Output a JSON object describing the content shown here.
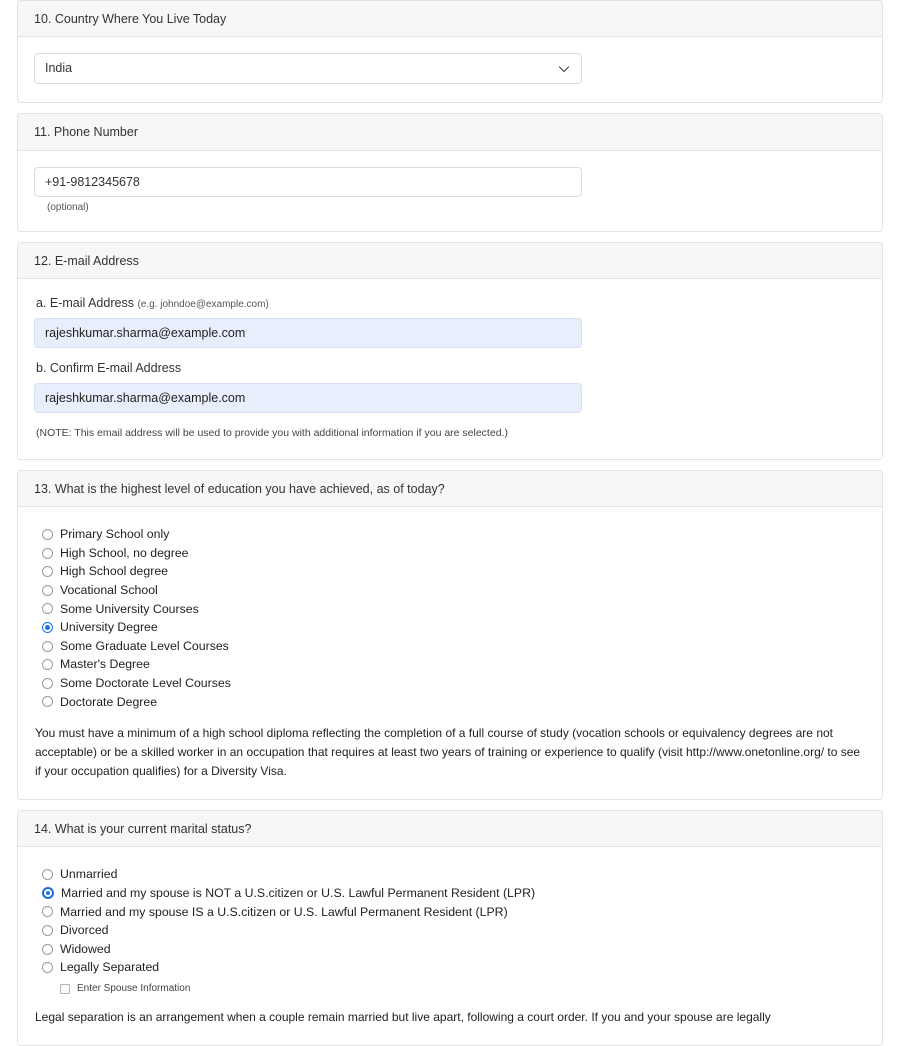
{
  "sections": [
    {
      "id": "country",
      "header": "10. Country Where You Live Today",
      "select_value": "India",
      "chevron_icon": "chevron-down-icon"
    },
    {
      "id": "phone",
      "header": "11. Phone Number",
      "phone_value": "+91-9812345678",
      "optional_note": "(optional)"
    },
    {
      "id": "email",
      "header": "12. E-mail Address",
      "email_label": "a. E-mail Address",
      "email_example": "(e.g. johndoe@example.com)",
      "email_value": "rajeshkumar.sharma@example.com",
      "confirm_label": "b. Confirm E-mail Address",
      "confirm_value": "rajeshkumar.sharma@example.com",
      "note": "(NOTE: This email address will be used to provide you with additional information if you are selected.)"
    },
    {
      "id": "education",
      "header": "13. What is the highest level of education you have achieved, as of today?",
      "options": [
        {
          "label": "Primary School only",
          "selected": false
        },
        {
          "label": "High School, no degree",
          "selected": false
        },
        {
          "label": "High School degree",
          "selected": false
        },
        {
          "label": "Vocational School",
          "selected": false
        },
        {
          "label": "Some University Courses",
          "selected": false
        },
        {
          "label": "University Degree",
          "selected": true
        },
        {
          "label": "Some Graduate Level Courses",
          "selected": false
        },
        {
          "label": "Master's Degree",
          "selected": false
        },
        {
          "label": "Some Doctorate Level Courses",
          "selected": false
        },
        {
          "label": "Doctorate Degree",
          "selected": false
        }
      ],
      "helper": "You must have a minimum of a high school diploma reflecting the completion of a full course of study (vocation schools or equivalency degrees are not acceptable) or be a skilled worker in an occupation that requires at least two years of training or experience to qualify (visit http://www.onetonline.org/ to see if your occupation qualifies) for a Diversity Visa."
    },
    {
      "id": "marital",
      "header": "14. What is your current marital status?",
      "options": [
        {
          "label": "Unmarried",
          "selected": false,
          "focused": false
        },
        {
          "label": "Married and my spouse is NOT a U.S.citizen or U.S. Lawful Permanent Resident (LPR)",
          "selected": true,
          "focused": true
        },
        {
          "label": "Married and my spouse IS a U.S.citizen or U.S. Lawful Permanent Resident (LPR)",
          "selected": false,
          "focused": false
        },
        {
          "label": "Divorced",
          "selected": false,
          "focused": false
        },
        {
          "label": "Widowed",
          "selected": false,
          "focused": false
        },
        {
          "label": "Legally Separated",
          "selected": false,
          "focused": false
        }
      ],
      "spouse_checkbox_label": "Enter Spouse Information",
      "spouse_checkbox_checked": false,
      "helper": "Legal separation is an arrangement when a couple remain married but live apart, following a court order. If you and your spouse are legally"
    }
  ],
  "colors": {
    "accent": "#1a73e8",
    "autofill_bg": "#e8eefb",
    "header_bg": "#f7f7f7",
    "border": "#e3e3e3"
  }
}
